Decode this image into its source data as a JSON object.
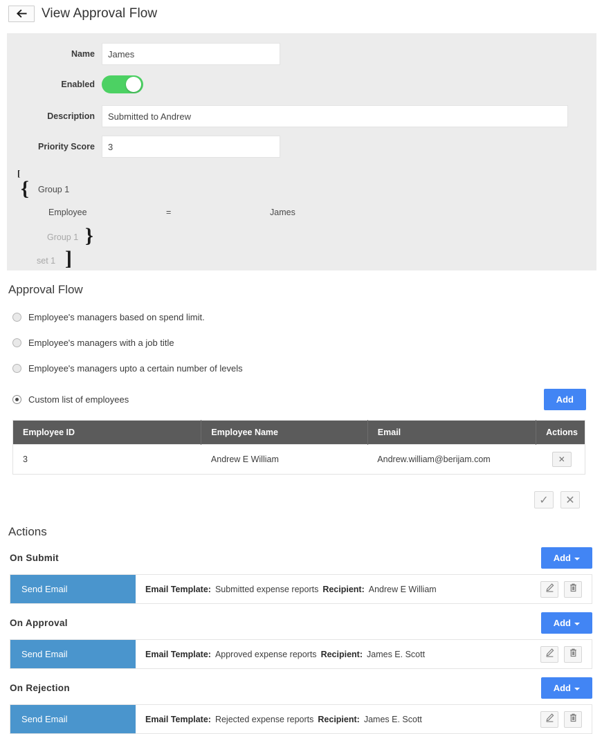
{
  "header": {
    "back_icon": "back-arrow-icon",
    "title": "View Approval Flow"
  },
  "details": {
    "name_label": "Name",
    "name_value": "James",
    "enabled_label": "Enabled",
    "enabled_state": "on",
    "description_label": "Description",
    "description_value": "Submitted to Andrew",
    "priority_label": "Priority Score",
    "priority_value": "3"
  },
  "condition": {
    "set_open": "[",
    "group_open": "{",
    "group_open_label": "Group 1",
    "field": "Employee",
    "operator": "=",
    "value": "James",
    "group_close_label": "Group 1",
    "group_close": "}",
    "set_close_label": "set 1",
    "set_close": "]"
  },
  "approval_flow": {
    "title": "Approval Flow",
    "options": [
      {
        "label": "Employee's managers based on spend limit.",
        "selected": false
      },
      {
        "label": "Employee's managers with a job title",
        "selected": false
      },
      {
        "label": "Employee's managers upto a certain number of levels",
        "selected": false
      },
      {
        "label": "Custom list of employees",
        "selected": true
      }
    ],
    "add_label": "Add"
  },
  "employee_table": {
    "columns": [
      "Employee ID",
      "Employee Name",
      "Email",
      "Actions"
    ],
    "rows": [
      {
        "id": "3",
        "name": "Andrew E William",
        "email": "Andrew.william@berijam.com",
        "action_icon": "✕"
      }
    ]
  },
  "confirm": {
    "accept_icon": "✓",
    "cancel_icon": "✕"
  },
  "actions": {
    "title": "Actions",
    "blocks": [
      {
        "heading": "On Submit",
        "add_label": "Add",
        "badge": "Send Email",
        "template_label": "Email Template:",
        "template_value": "Submitted expense reports",
        "recipient_label": "Recipient:",
        "recipient_value": "Andrew E William"
      },
      {
        "heading": "On Approval",
        "add_label": "Add",
        "badge": "Send Email",
        "template_label": "Email Template:",
        "template_value": "Approved expense reports",
        "recipient_label": "Recipient:",
        "recipient_value": "James E. Scott"
      },
      {
        "heading": "On Rejection",
        "add_label": "Add",
        "badge": "Send Email",
        "template_label": "Email Template:",
        "template_value": "Rejected expense reports",
        "recipient_label": "Recipient:",
        "recipient_value": "James E. Scott"
      }
    ]
  },
  "colors": {
    "accent_blue": "#4285f4",
    "badge_blue": "#4a95cd",
    "toggle_green": "#4cd163",
    "table_header": "#5b5b5b",
    "panel_gray": "#ececec"
  }
}
